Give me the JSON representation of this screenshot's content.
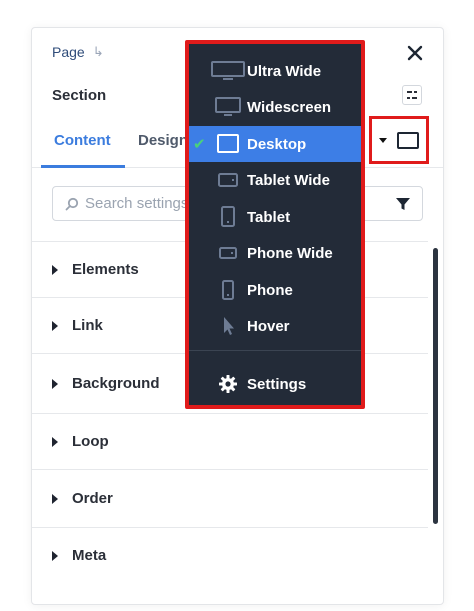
{
  "breadcrumb": {
    "page": "Page",
    "arrow": "↳"
  },
  "section": {
    "title": "Section"
  },
  "tabs": [
    {
      "label": "Content"
    },
    {
      "label": "Design"
    }
  ],
  "search": {
    "placeholder": "Search settings"
  },
  "sections": [
    {
      "label": "Elements"
    },
    {
      "label": "Link"
    },
    {
      "label": "Background"
    },
    {
      "label": "Loop"
    },
    {
      "label": "Order"
    },
    {
      "label": "Meta"
    }
  ],
  "breakpoint_menu": {
    "items": [
      {
        "label": "Ultra Wide",
        "icon": "ultra-wide-icon"
      },
      {
        "label": "Widescreen",
        "icon": "widescreen-icon"
      },
      {
        "label": "Desktop",
        "icon": "desktop-icon",
        "selected": true
      },
      {
        "label": "Tablet Wide",
        "icon": "tablet-wide-icon"
      },
      {
        "label": "Tablet",
        "icon": "tablet-icon"
      },
      {
        "label": "Phone Wide",
        "icon": "phone-wide-icon"
      },
      {
        "label": "Phone",
        "icon": "phone-icon"
      },
      {
        "label": "Hover",
        "icon": "cursor-icon"
      }
    ],
    "settings_label": "Settings",
    "check_glyph": "✔"
  },
  "colors": {
    "accent": "#3b7cde",
    "menu_bg": "#232b38",
    "highlight_border": "#e01b1b",
    "check": "#4ad17c"
  }
}
